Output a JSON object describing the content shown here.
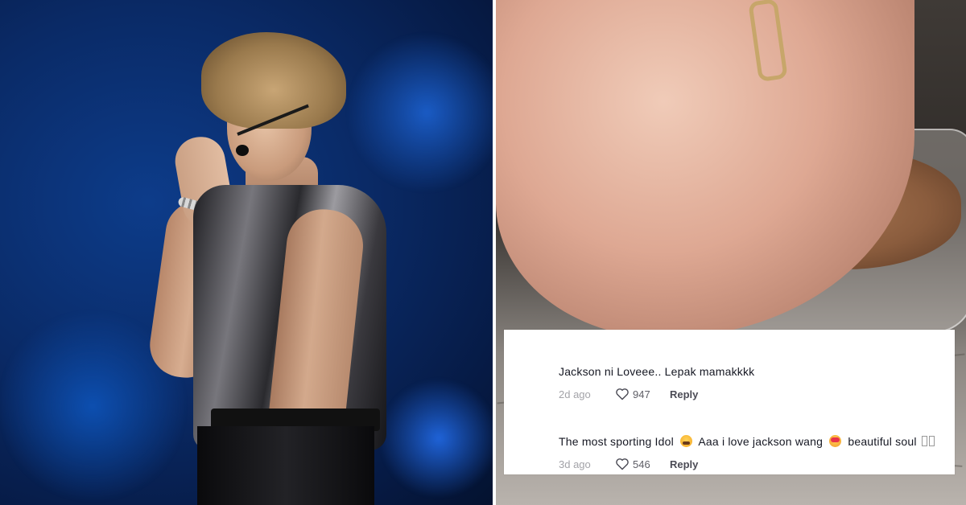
{
  "left_photo": {
    "subject": "performer on stage",
    "background_color": "#0a2a66"
  },
  "right_photo": {
    "subject": "hand holding cup of cocoa drink"
  },
  "comments": [
    {
      "text_parts": [
        "Jackson ni Loveee.. Lepak mamakkkk"
      ],
      "date": "2d ago",
      "likes": "947",
      "reply_label": "Reply"
    },
    {
      "text_parts": [
        "The most sporting Idol",
        "Aaa i love jackson wang",
        "beautiful soul"
      ],
      "emojis": [
        "crying-face-emoji",
        "smiling-face-with-hearts-emoji"
      ],
      "date": "3d ago",
      "likes": "546",
      "reply_label": "Reply"
    }
  ],
  "colors": {
    "comment_text": "#161823",
    "date_text": "#a3a3a8",
    "card_background": "#ffffff"
  },
  "icons": {
    "like": "heart-outline-icon"
  }
}
